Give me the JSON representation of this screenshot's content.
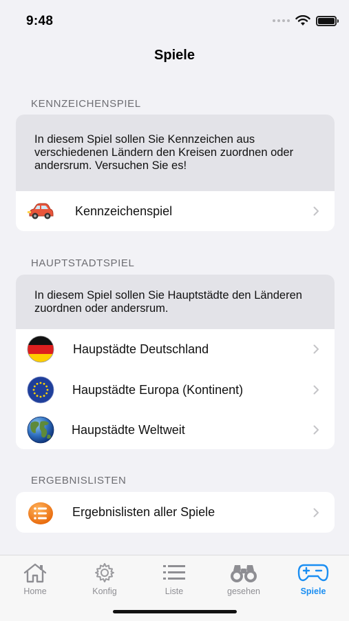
{
  "status": {
    "time": "9:48"
  },
  "nav": {
    "title": "Spiele"
  },
  "sections": {
    "kennzeichen": {
      "header": "KENNZEICHENSPIEL",
      "description": "In diesem Spiel sollen Sie Kennzeichen aus verschiedenen Ländern den Kreisen zuordnen oder andersrum. Versuchen Sie es!",
      "items": [
        {
          "label": "Kennzeichenspiel",
          "icon": "car-icon"
        }
      ]
    },
    "hauptstadt": {
      "header": "HAUPTSTADTSPIEL",
      "description": "In diesem Spiel sollen Sie Hauptstädte den Länderen zuordnen oder andersrum.",
      "items": [
        {
          "label": "Haupstädte Deutschland",
          "icon": "germany-flag-icon"
        },
        {
          "label": "Haupstädte Europa (Kontinent)",
          "icon": "eu-flag-icon"
        },
        {
          "label": "Haupstädte Weltweit",
          "icon": "globe-icon"
        }
      ]
    },
    "ergebnis": {
      "header": "ERGEBNISLISTEN",
      "items": [
        {
          "label": "Ergebnislisten aller Spiele",
          "icon": "list-icon"
        }
      ]
    }
  },
  "tabs": [
    {
      "label": "Home",
      "icon": "home-icon",
      "active": false
    },
    {
      "label": "Konfig",
      "icon": "gear-icon",
      "active": false
    },
    {
      "label": "Liste",
      "icon": "list-lines-icon",
      "active": false
    },
    {
      "label": "gesehen",
      "icon": "binoculars-icon",
      "active": false
    },
    {
      "label": "Spiele",
      "icon": "gamepad-icon",
      "active": true
    }
  ],
  "colors": {
    "accent": "#1a8ef2",
    "background": "#f2f2f6",
    "inactive_tab": "#8e8e93"
  }
}
